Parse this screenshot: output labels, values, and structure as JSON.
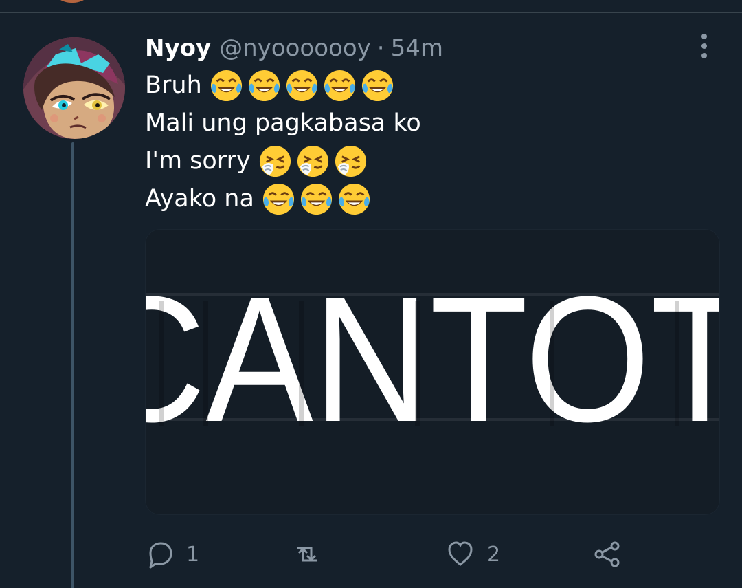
{
  "tweet": {
    "display_name": "Nyoy",
    "handle": "@nyooooooy",
    "separator": "·",
    "time": "54m",
    "lines": [
      {
        "text": "Bruh",
        "emoji": [
          "face-with-tears-of-joy",
          "face-with-tears-of-joy",
          "face-with-tears-of-joy",
          "face-with-tears-of-joy",
          "face-with-tears-of-joy"
        ]
      },
      {
        "text": "Mali ung pagkabasa ko",
        "emoji": []
      },
      {
        "text": "I'm sorry",
        "emoji": [
          "sneezing-face",
          "sneezing-face",
          "sneezing-face"
        ]
      },
      {
        "text": "Ayako na",
        "emoji": [
          "face-with-tears-of-joy",
          "face-with-tears-of-joy",
          "face-with-tears-of-joy"
        ]
      }
    ],
    "media": {
      "visible_text": "CANTOT"
    },
    "actions": {
      "reply_count": "1",
      "retweet_count": "",
      "like_count": "2"
    }
  },
  "icons": {
    "reply": "reply-icon",
    "retweet": "retweet-icon",
    "like": "heart-icon",
    "share": "share-icon",
    "more": "more-vertical-icon"
  },
  "colors": {
    "background": "#15202b",
    "secondary_text": "#8b98a5",
    "divider": "#38444d",
    "thread_line": "#3d5466"
  }
}
